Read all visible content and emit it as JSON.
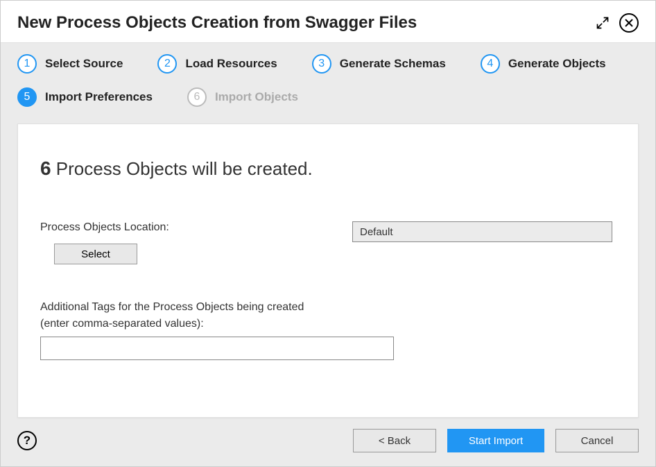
{
  "header": {
    "title": "New Process Objects Creation from Swagger Files"
  },
  "steps": [
    {
      "num": "1",
      "label": "Select Source",
      "state": "done"
    },
    {
      "num": "2",
      "label": "Load Resources",
      "state": "done"
    },
    {
      "num": "3",
      "label": "Generate Schemas",
      "state": "done"
    },
    {
      "num": "4",
      "label": "Generate Objects",
      "state": "done"
    },
    {
      "num": "5",
      "label": "Import Preferences",
      "state": "active"
    },
    {
      "num": "6",
      "label": "Import Objects",
      "state": "pending"
    }
  ],
  "content": {
    "count": "6",
    "summary_suffix": " Process Objects will be created.",
    "location_label": "Process Objects Location:",
    "location_value": "Default",
    "select_btn": "Select",
    "tags_label_line1": "Additional Tags for the Process Objects being created",
    "tags_label_line2": "(enter comma-separated values):",
    "tags_value": ""
  },
  "footer": {
    "help": "?",
    "back": "< Back",
    "start": "Start Import",
    "cancel": "Cancel"
  }
}
